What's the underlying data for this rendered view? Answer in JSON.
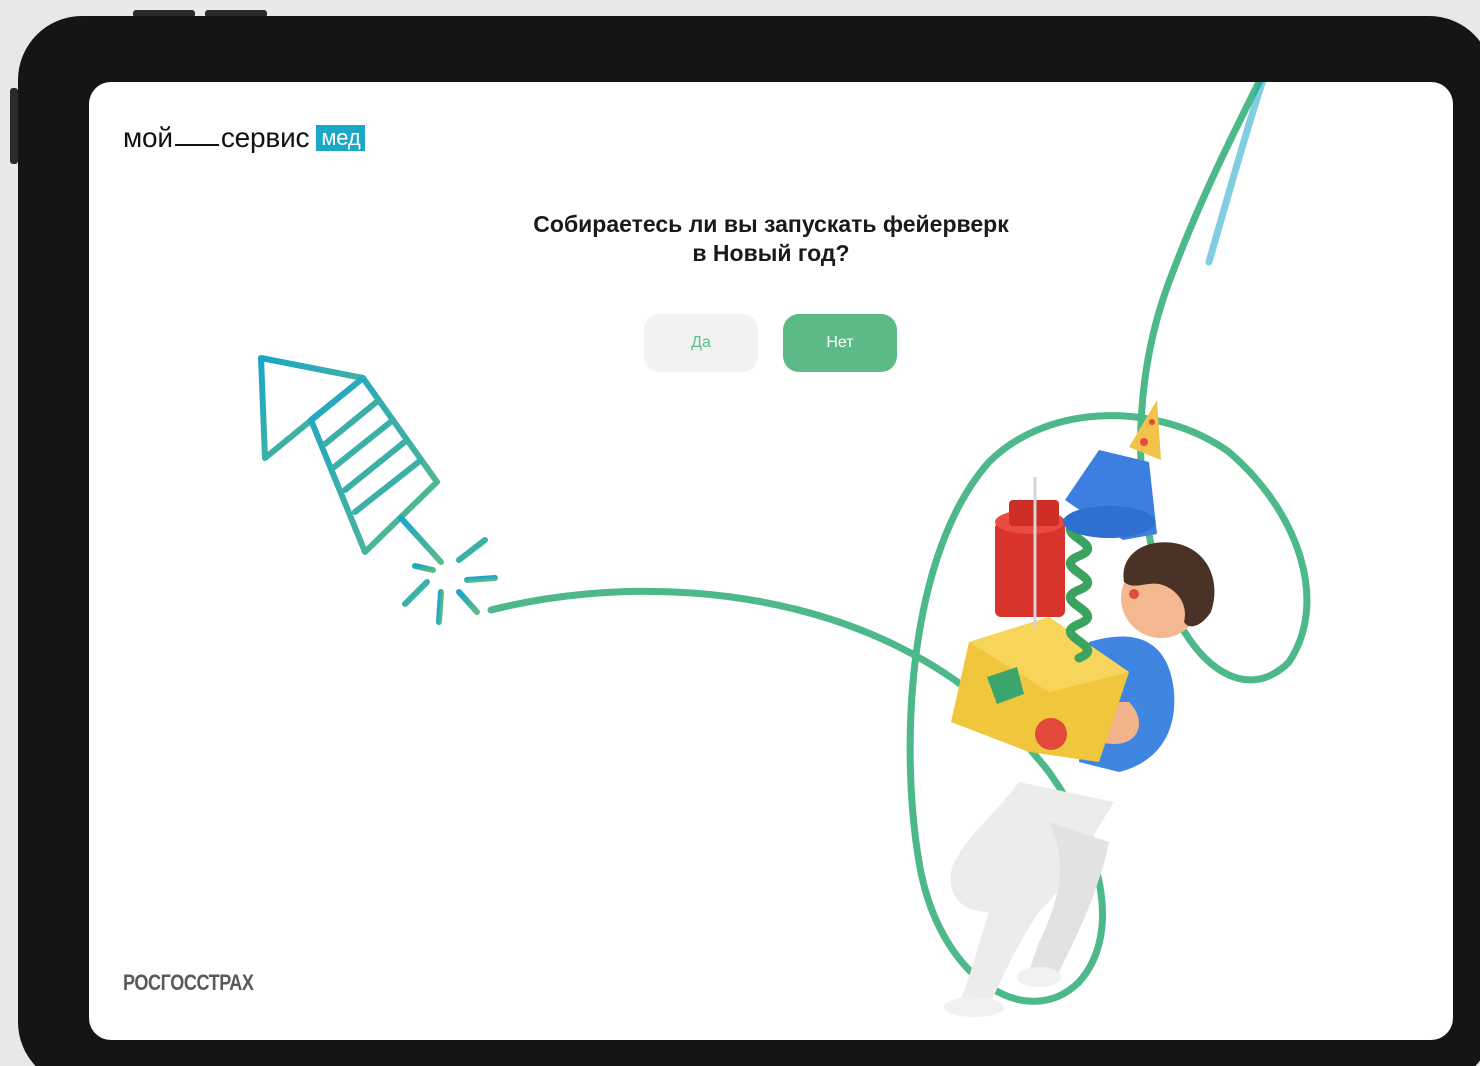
{
  "brand": {
    "part1": "мой",
    "part2": "сервис",
    "badge": "мед",
    "badge_color": "#1ba7c6"
  },
  "question": {
    "line1": "Собираетесь ли вы запускать фейерверк",
    "line2": "в Новый год?"
  },
  "buttons": {
    "yes_label": "Да",
    "no_label": "Нет",
    "accent_color": "#5cba86"
  },
  "footer": {
    "company": "РОСГОССТРАХ"
  },
  "icons": [
    "firework-rocket-icon",
    "person-with-gifts-illustration"
  ]
}
